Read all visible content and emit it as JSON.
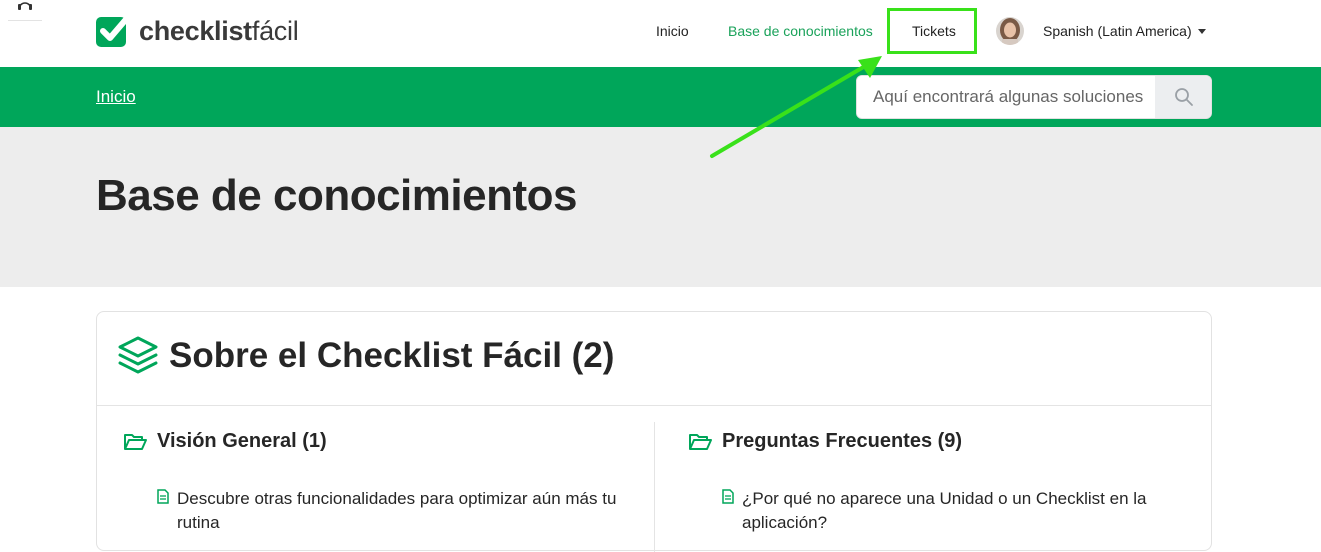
{
  "header": {
    "logo_bold": "checklist",
    "logo_light": "fácil",
    "nav": {
      "inicio": "Inicio",
      "knowledge_base": "Base de conocimientos",
      "tickets": "Tickets"
    },
    "language": "Spanish (Latin America)"
  },
  "subheader": {
    "breadcrumb": "Inicio",
    "search_placeholder": "Aquí encontrará algunas soluciones"
  },
  "hero": {
    "title": "Base de conocimientos"
  },
  "category": {
    "title": "Sobre el Checklist Fácil (2)",
    "sections": [
      {
        "title": "Visión General (1)",
        "articles": [
          "Descubre otras funcionalidades para optimizar aún más tu rutina"
        ]
      },
      {
        "title": "Preguntas Frecuentes (9)",
        "articles": [
          "¿Por qué no aparece una Unidad o un Checklist en la aplicación?"
        ]
      }
    ]
  },
  "colors": {
    "brand_green": "#00a65a",
    "nav_active": "#1aa25a",
    "highlight": "#39e11a",
    "hero_bg": "#ededed"
  },
  "icons": [
    "headset-icon",
    "checklist-logo-icon",
    "search-icon",
    "layers-icon",
    "folder-open-icon",
    "document-icon",
    "caret-down-icon"
  ]
}
